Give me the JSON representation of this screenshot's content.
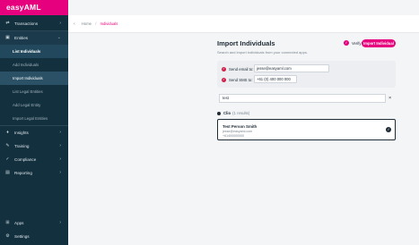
{
  "brand": {
    "name": "easyAML"
  },
  "sidebar": {
    "items": [
      {
        "label": "Transactions",
        "icon": "transactions-icon",
        "glyph": "⇄"
      },
      {
        "label": "Entities",
        "icon": "entities-icon",
        "glyph": "▣"
      }
    ],
    "entities_sub": [
      {
        "label": "List Individuals"
      },
      {
        "label": "Add Individuals"
      }
    ],
    "import_group": {
      "label": "Import Individuals"
    },
    "legal_sub": [
      {
        "label": "List Legal Entities"
      },
      {
        "label": "Add Legal Entity"
      },
      {
        "label": "Import Legal Entities"
      }
    ],
    "lower_items": [
      {
        "label": "Insights",
        "glyph": "♦"
      },
      {
        "label": "Training",
        "glyph": "✎"
      },
      {
        "label": "Compliance",
        "glyph": "✓"
      },
      {
        "label": "Reporting",
        "glyph": "▤"
      }
    ],
    "bottom_items": [
      {
        "label": "Apps",
        "glyph": "⊞"
      },
      {
        "label": "Settings",
        "glyph": "⚙"
      }
    ]
  },
  "breadcrumb": {
    "home": "Home",
    "current": "Individuals"
  },
  "page": {
    "title": "Import Individuals",
    "subtitle": "Search and import individuals from your connected apps."
  },
  "actions": {
    "verify_label": "Verify",
    "import_label": "Import Individual"
  },
  "send": {
    "email_label": "Send email to:",
    "email_value": "jesse@easyaml.com",
    "sms_label": "Send SMS to:",
    "sms_value": "+61 (0) 400 000 000"
  },
  "search": {
    "value": "test"
  },
  "results": {
    "source": "Clio",
    "count_text": "(1 results)",
    "items": [
      {
        "name": "Test Person Smith",
        "email": "jesse@easyaml.com",
        "phone": "+61400000000"
      }
    ]
  },
  "colors": {
    "brand": "#e6007e",
    "sidebar": "#13303f",
    "required": "#d01e4a"
  }
}
